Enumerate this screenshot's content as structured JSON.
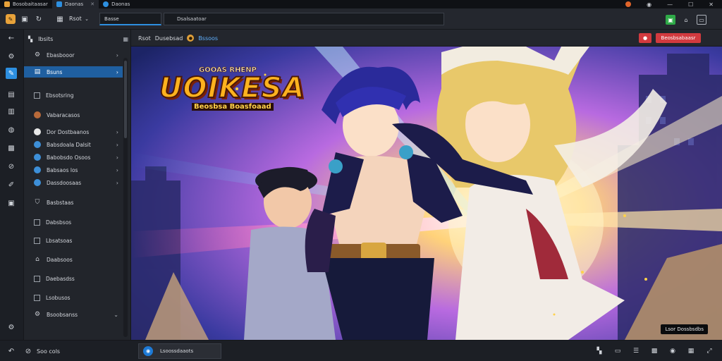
{
  "tabs": [
    {
      "label": "Bosobaitaasar",
      "icon": "app-icon",
      "active": false
    },
    {
      "label": "Daonas",
      "icon": "doc-icon",
      "active": true
    },
    {
      "label": "Daonas",
      "icon": "doc-icon",
      "active": false
    }
  ],
  "toolbar": {
    "nav_label": "Rsot",
    "search_value": "Basse",
    "address_value": "Dsalsaatoar"
  },
  "sidebar": {
    "header": "Ibsits",
    "items": [
      {
        "label": "Ebasbooor",
        "icon": "gear-icon",
        "chevron": true,
        "selected": false
      },
      {
        "label": "Bsuns",
        "icon": "folder-icon",
        "chevron": true,
        "selected": true
      },
      {
        "label": "Ebsotsring",
        "icon": "checkbox-icon",
        "chevron": false,
        "selected": false
      },
      {
        "label": "Vabaracasos",
        "icon": "avatar-icon",
        "chevron": false,
        "selected": false
      },
      {
        "label": "Dor Dostbaanos",
        "icon": "radio-icon",
        "chevron": true,
        "selected": false
      },
      {
        "label": "Babsdoala Dalsit",
        "icon": "blue-dot-icon",
        "chevron": true,
        "selected": false
      },
      {
        "label": "Babobsdo Osoos",
        "icon": "blue-dot-icon",
        "chevron": true,
        "selected": false
      },
      {
        "label": "Babsaos los",
        "icon": "blue-dot-icon",
        "chevron": true,
        "selected": false
      },
      {
        "label": "Dassdoosaas",
        "icon": "blue-dot-icon",
        "chevron": true,
        "selected": false
      },
      {
        "label": "Basbstaas",
        "icon": "shield-icon",
        "chevron": false,
        "selected": false
      },
      {
        "label": "Dabsbsos",
        "icon": "checkbox-icon",
        "chevron": false,
        "selected": false
      },
      {
        "label": "Lbsatsoas",
        "icon": "checkbox-icon",
        "chevron": false,
        "selected": false
      },
      {
        "label": "Daabsoos",
        "icon": "home-icon",
        "chevron": false,
        "selected": false
      },
      {
        "label": "Daebasdss",
        "icon": "checkbox-icon",
        "chevron": false,
        "selected": false
      },
      {
        "label": "Lsobusos",
        "icon": "checkbox-icon",
        "chevron": false,
        "selected": false
      },
      {
        "label": "Bsoobsanss",
        "icon": "gear-icon",
        "chevron": true,
        "selected": false
      }
    ]
  },
  "content": {
    "title": "Rsot",
    "title_sub": "Dusebsad",
    "title_subtitle": "Bssoos",
    "action_small": "",
    "action_label": "Beosbsabaasr",
    "artwork": {
      "logo_top": "GOOAS RHENP",
      "logo_main": "UOIKESA",
      "logo_sub": "Beosbsa Boasfoaad",
      "watermark": "Lsor Dossbsdbs"
    }
  },
  "statusbar": {
    "label": "Soo cols",
    "tab_label": "Lsoossdaaots"
  },
  "colors": {
    "accent": "#2d8fe0",
    "selected_bg": "#1f5fa0",
    "danger": "#d23a3f",
    "success": "#2faa48",
    "panel": "#22252b",
    "chrome": "#1c1f25"
  }
}
